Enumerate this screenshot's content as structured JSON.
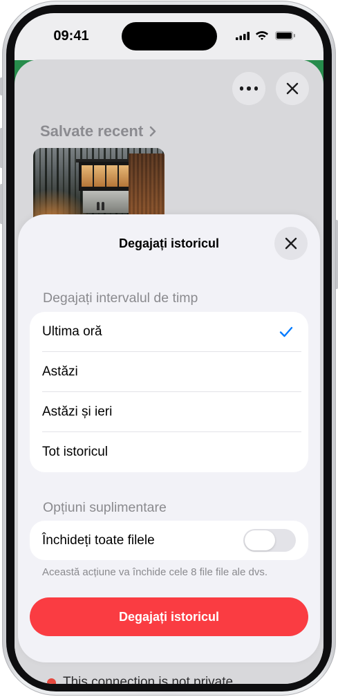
{
  "status_bar": {
    "time": "09:41"
  },
  "start_page": {
    "saved_recently_heading": "Salvate recent",
    "bottom_row_text": "This connection is not private"
  },
  "clear_history_sheet": {
    "title": "Degajați istoricul",
    "time_range_section_header": "Degajați intervalul de timp",
    "time_range_options": [
      {
        "label": "Ultima oră",
        "selected": true
      },
      {
        "label": "Astăzi",
        "selected": false
      },
      {
        "label": "Astăzi și ieri",
        "selected": false
      },
      {
        "label": "Tot istoricul",
        "selected": false
      }
    ],
    "additional_options_section_header": "Opțiuni suplimentare",
    "close_all_tabs_label": "Închideți toate filele",
    "close_all_tabs_enabled": false,
    "close_all_tabs_note": "Această acțiune va închide cele 8 file file ale dvs.",
    "clear_button_label": "Degajați istoricul"
  },
  "icons": {
    "signal": "cellular-signal-icon",
    "wifi": "wifi-icon",
    "battery": "battery-icon",
    "more": "ellipsis-icon",
    "close": "close-icon",
    "saved_recently_more": "chevron-right-icon",
    "selected_option": "checkmark-icon",
    "bottom_row": "warning-icon"
  },
  "colors": {
    "accent": "#007AFF",
    "destructive": "#FA3C42",
    "header_green": "#278C4C",
    "sheet_background": "#F2F2F7"
  }
}
